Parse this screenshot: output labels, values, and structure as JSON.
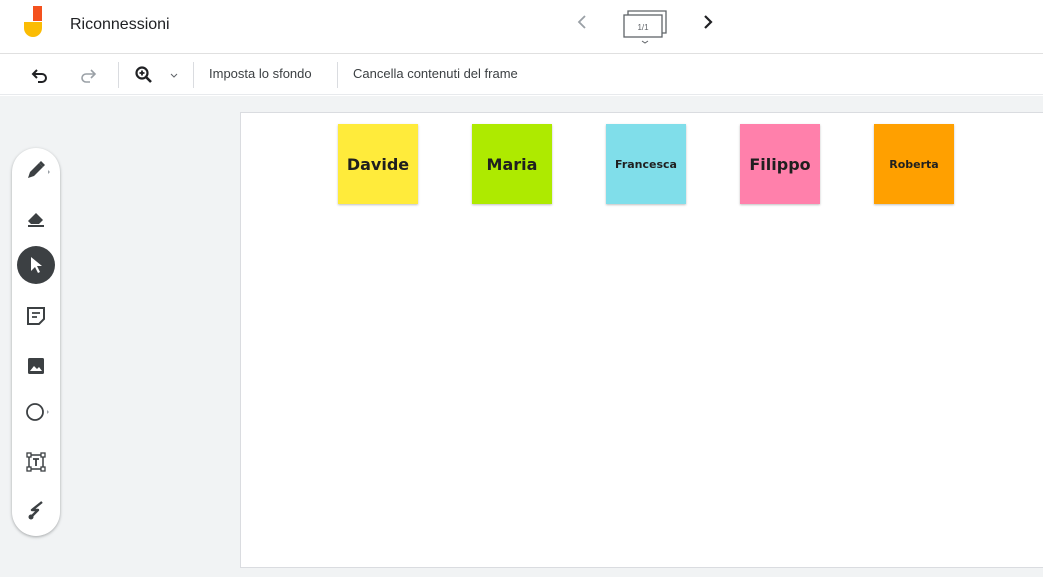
{
  "header": {
    "title": "Riconnessioni",
    "frame_counter": "1/1"
  },
  "toolbar": {
    "set_background": "Imposta lo sfondo",
    "clear_frame": "Cancella contenuti del frame"
  },
  "tools": [
    {
      "name": "pen-tool",
      "icon": "pen-icon"
    },
    {
      "name": "eraser-tool",
      "icon": "eraser-icon"
    },
    {
      "name": "select-tool",
      "icon": "cursor-icon",
      "active": true
    },
    {
      "name": "sticky-note-tool",
      "icon": "sticky-note-icon"
    },
    {
      "name": "image-tool",
      "icon": "image-icon"
    },
    {
      "name": "shape-tool",
      "icon": "circle-icon"
    },
    {
      "name": "text-box-tool",
      "icon": "text-box-icon"
    },
    {
      "name": "laser-tool",
      "icon": "laser-icon"
    }
  ],
  "notes": [
    {
      "text": "Davide",
      "color": "#ffeb3b"
    },
    {
      "text": "Maria",
      "color": "#aeea00"
    },
    {
      "text": "Francesca",
      "color": "#80deea"
    },
    {
      "text": "Filippo",
      "color": "#ff80ab"
    },
    {
      "text": "Roberta",
      "color": "#ffa000"
    }
  ]
}
